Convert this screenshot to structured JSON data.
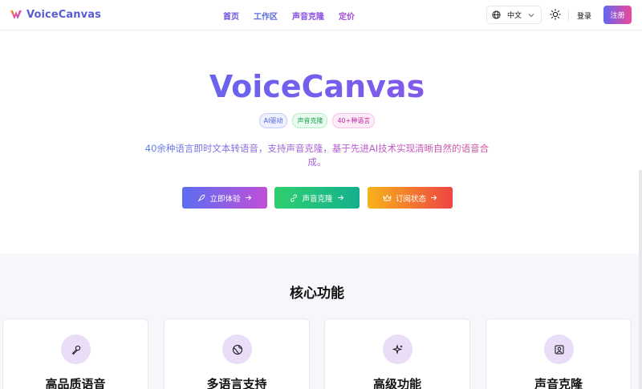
{
  "header": {
    "brand": "VoiceCanvas",
    "nav": [
      "首页",
      "工作区",
      "声音克隆",
      "定价"
    ],
    "language": "中文",
    "login": "登录",
    "signup": "注册"
  },
  "hero": {
    "title": "VoiceCanvas",
    "tags": [
      "AI驱动",
      "声音克隆",
      "40+种语言"
    ],
    "subtitle": "40余种语言即时文本转语音，支持声音克隆，基于先进AI技术实现清晰自然的语音合成。",
    "buttons": [
      {
        "label": "立即体验",
        "icon": "rocket-icon"
      },
      {
        "label": "声音克隆",
        "icon": "link-icon"
      },
      {
        "label": "订阅状态",
        "icon": "crown-icon"
      }
    ]
  },
  "features": {
    "title": "核心功能",
    "cards": [
      {
        "title": "高品质语音",
        "icon": "microphone-icon"
      },
      {
        "title": "多语言支持",
        "icon": "globe-icon"
      },
      {
        "title": "高级功能",
        "icon": "sparkles-icon"
      },
      {
        "title": "声音克隆",
        "icon": "user-square-icon"
      }
    ]
  },
  "colors": {
    "accent": "#6366f1",
    "accent_pink": "#ec4899",
    "green": "#22c55e",
    "orange": "#f59e0b",
    "red": "#ef4444"
  }
}
